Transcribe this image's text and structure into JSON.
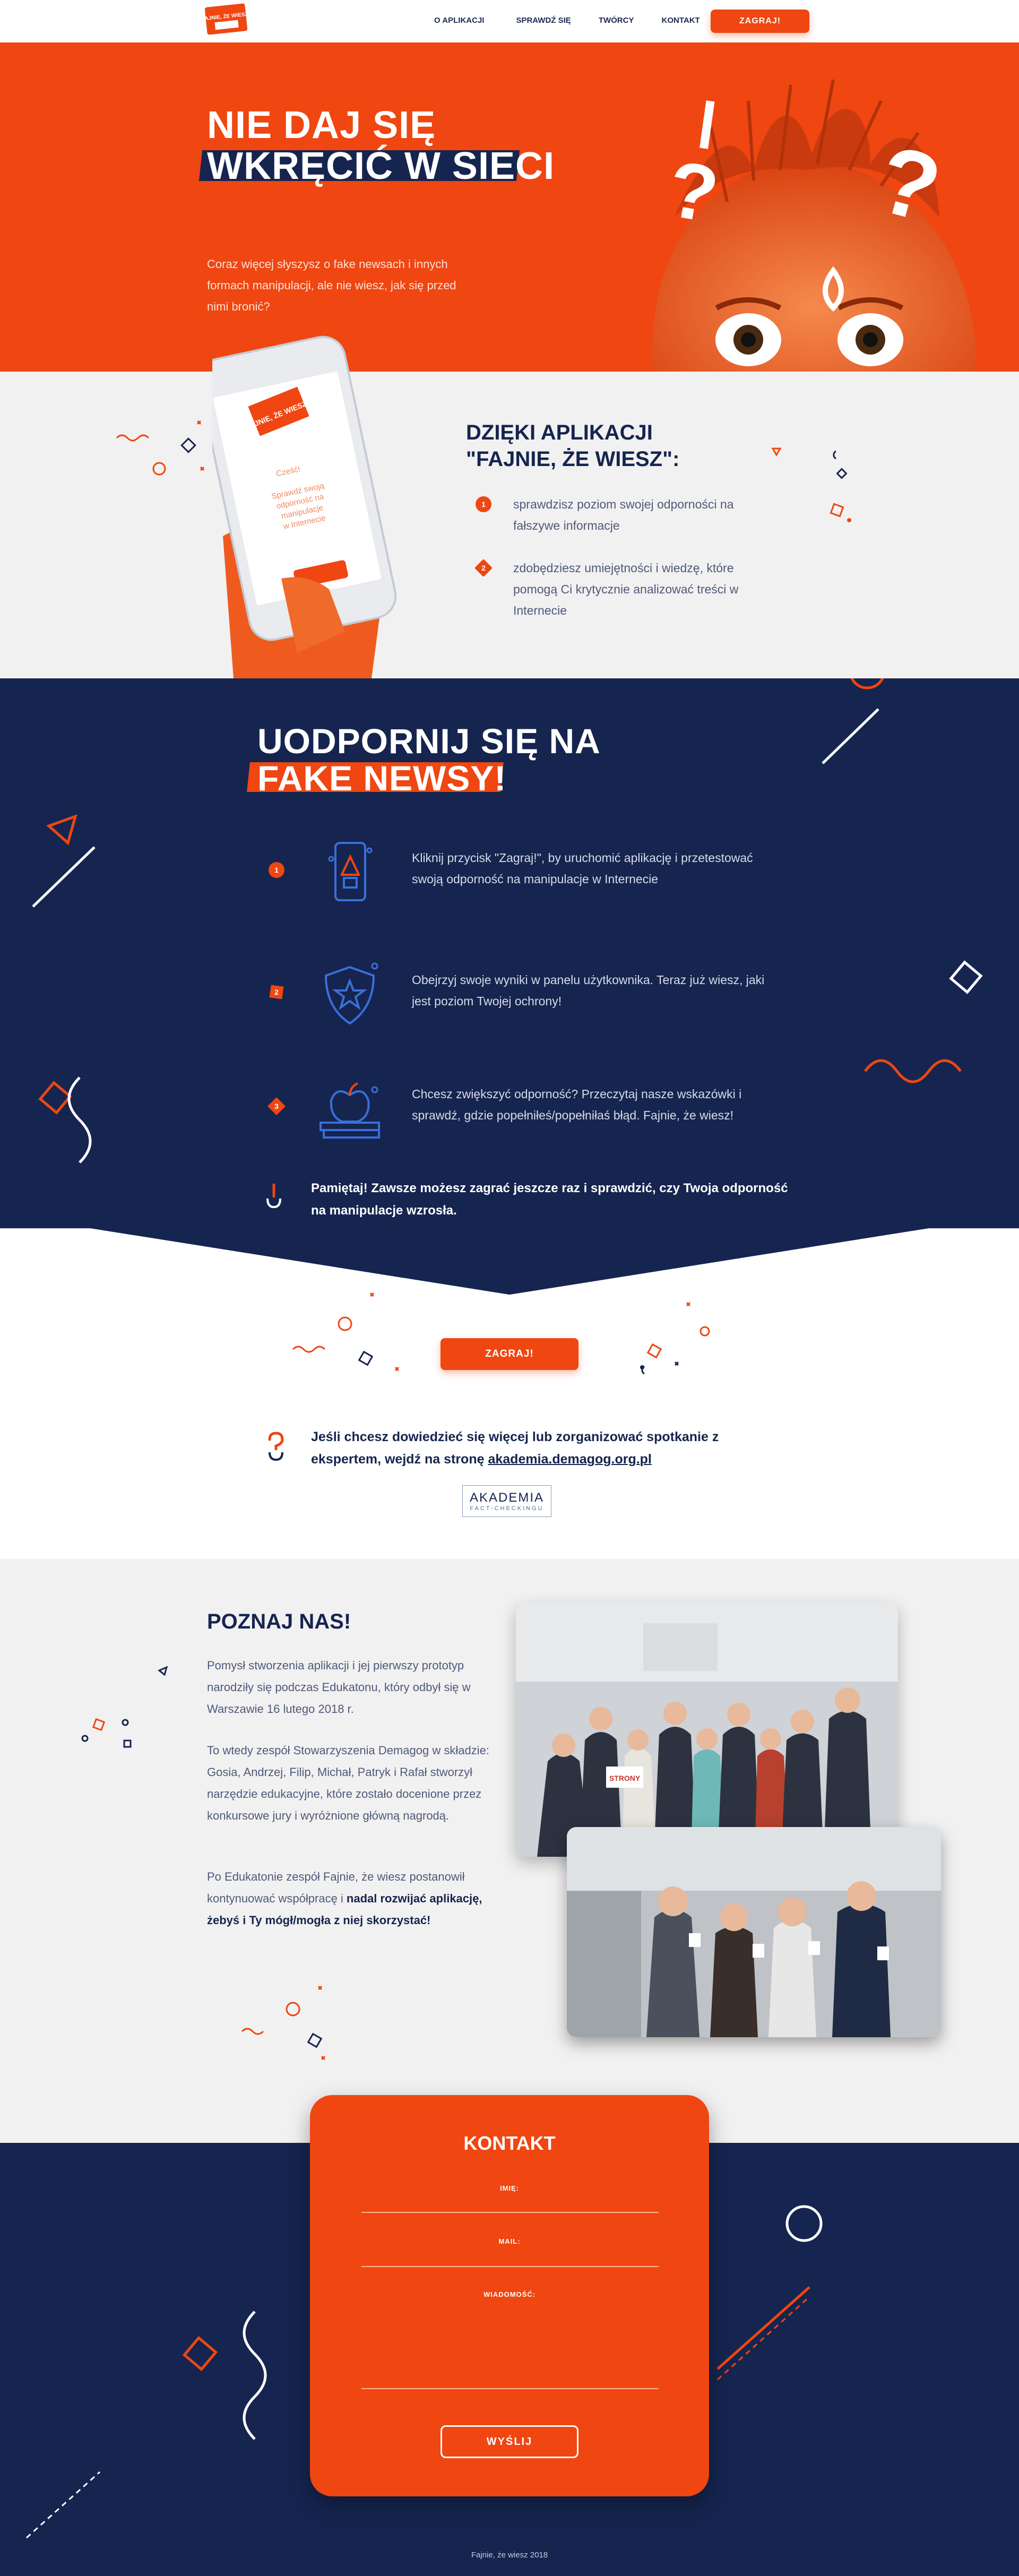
{
  "nav": {
    "logo_text": "FAJNIE, ŻE WIESZ!",
    "links": [
      "O APLIKACJI",
      "SPRAWDŹ SIĘ",
      "TWÓRCY",
      "KONTAKT"
    ],
    "play_label": "ZAGRAJ!"
  },
  "hero": {
    "title_line1": "NIE DAJ SIĘ",
    "title_line2": "WKRĘCIĆ W SIECI",
    "lead": "Coraz więcej słyszysz o fake newsach i innych formach manipulacji, ale nie wiesz, jak się przed nimi bronić?"
  },
  "app": {
    "title_line1": "DZIĘKI APLIKACJI",
    "title_line2": "\"FAJNIE, ŻE WIESZ\":",
    "phone_logo": "FAJNIE, ŻE WIESZ!",
    "phone_greeting": "Cześć!",
    "phone_text": "Sprawdź swoją odporność na manipulacje w Internecie",
    "items": [
      {
        "num": "1",
        "text": "sprawdzisz poziom swojej odporności na fałszywe informacje"
      },
      {
        "num": "2",
        "text": "zdobędziesz umiejętności i wiedzę, które pomogą Ci krytycznie analizować treści w Internecie"
      }
    ]
  },
  "steps": {
    "title_line1": "UODPORNIJ SIĘ NA",
    "title_line2": "FAKE NEWSY!",
    "items": [
      {
        "num": "1",
        "icon": "phone-icon",
        "text": "Kliknij przycisk \"Zagraj!\", by uruchomić aplikację i przetestować swoją odporność na manipulacje w Internecie"
      },
      {
        "num": "2",
        "icon": "shield-icon",
        "text": "Obejrzyj swoje wyniki w panelu użytkownika. Teraz już wiesz, jaki jest poziom Twojej ochrony!"
      },
      {
        "num": "3",
        "icon": "apple-books-icon",
        "text": "Chcesz zwiększyć odporność? Przeczytaj nasze wskazówki i sprawdź, gdzie popełniłeś/popełniłaś błąd. Fajnie, że wiesz!"
      }
    ],
    "note": "Pamiętaj! Zawsze możesz zagrać jeszcze raz i sprawdzić, czy Twoja odporność na manipulacje wzrosła."
  },
  "cta": {
    "play_label": "ZAGRAJ!",
    "more_text": "Jeśli chcesz dowiedzieć się więcej lub zorganizować spotkanie z ekspertem, wejdź na stronę",
    "more_link": "akademia.demagog.org.pl",
    "akademia_line1": "AKADEMIA",
    "akademia_line2": "FACT-CHECKINGU"
  },
  "about": {
    "title": "POZNAJ NAS!",
    "p1": "Pomysł stworzenia aplikacji i jej pierwszy prototyp narodziły się podczas Edukatonu, który odbył się w Warszawie 16 lutego 2018 r.",
    "p2": "To wtedy zespół Stowarzyszenia Demagog w składzie: Gosia, Andrzej, Filip, Michał, Patryk i Rafał stworzył narzędzie edukacyjne, które zostało docenione przez konkursowe jury i wyróżnione główną nagrodą.",
    "p3_plain": "Po Edukatonie zespół Fajnie, że wiesz postanowił kontynuować współpracę i ",
    "p3_bold": "nadal rozwijać aplikację, żebyś i Ty mógł/mogła z niej skorzystać!",
    "sign_text": "STRONY"
  },
  "contact": {
    "title": "KONTAKT",
    "name_label": "IMIĘ:",
    "mail_label": "MAIL:",
    "message_label": "WIADOMOŚĆ:",
    "send_label": "WYŚLIJ",
    "footer": "Fajnie, że wiesz 2018"
  },
  "colors": {
    "orange": "#ef4612",
    "navy": "#15254f",
    "light_gray": "#f2f1f1"
  }
}
